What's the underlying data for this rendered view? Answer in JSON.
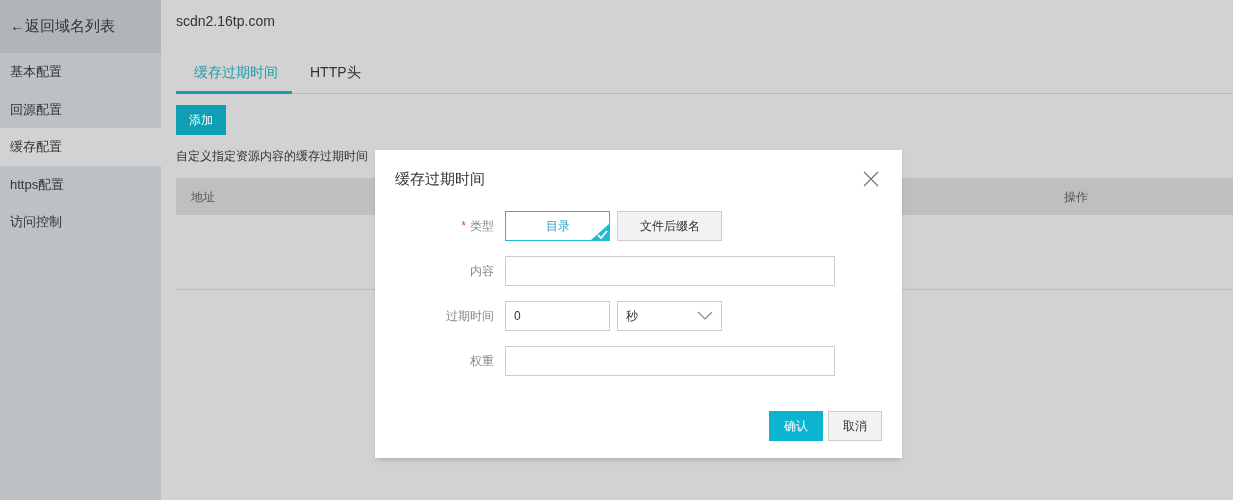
{
  "sidebar": {
    "back_link": "←返回域名列表",
    "items": [
      {
        "label": "基本配置",
        "selected": false
      },
      {
        "label": "回源配置",
        "selected": false
      },
      {
        "label": "缓存配置",
        "selected": true
      },
      {
        "label": "https配置",
        "selected": false
      },
      {
        "label": "访问控制",
        "selected": false
      }
    ]
  },
  "page": {
    "domain": "scdn2.16tp.com",
    "tabs": [
      {
        "label": "缓存过期时间",
        "selected": true
      },
      {
        "label": "HTTP头",
        "selected": false
      }
    ],
    "add_button": "添加",
    "description": "自定义指定资源内容的缓存过期时间",
    "table": {
      "columns": [
        "地址",
        "操作"
      ]
    }
  },
  "dialog": {
    "title": "缓存过期时间",
    "type": {
      "label": "类型",
      "required_mark": "*",
      "options": [
        {
          "label": "目录",
          "selected": true
        },
        {
          "label": "文件后缀名",
          "selected": false
        }
      ]
    },
    "content": {
      "label": "内容"
    },
    "expire": {
      "label": "过期时间",
      "value": "0",
      "unit": "秒"
    },
    "weight": {
      "label": "权重"
    },
    "buttons": [
      {
        "label": "确认",
        "kind": "primary"
      },
      {
        "label": "取消",
        "kind": "secondary"
      }
    ]
  }
}
